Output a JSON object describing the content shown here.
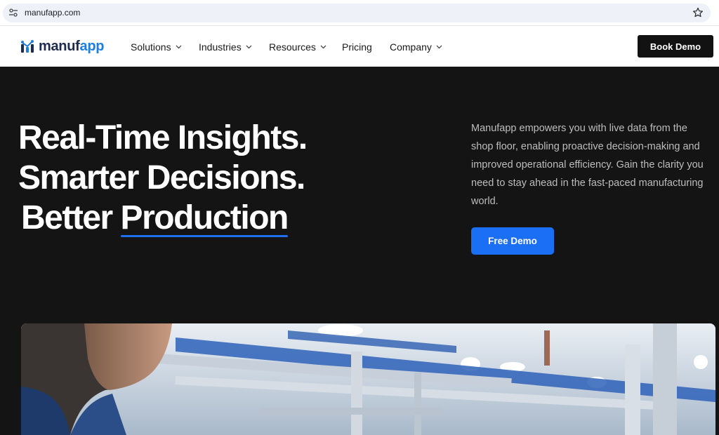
{
  "browser": {
    "url": "manufapp.com"
  },
  "nav": {
    "logo": {
      "part1": "manuf",
      "part2": "app"
    },
    "items": [
      {
        "label": "Solutions",
        "has_dropdown": true
      },
      {
        "label": "Industries",
        "has_dropdown": true
      },
      {
        "label": "Resources",
        "has_dropdown": true
      },
      {
        "label": "Pricing",
        "has_dropdown": false
      },
      {
        "label": "Company",
        "has_dropdown": true
      }
    ],
    "cta_label": "Book Demo"
  },
  "hero": {
    "headline": {
      "line1": "Real-Time Insights.",
      "line2": "Smarter Decisions.",
      "line3_prefix": "Better ",
      "line3_highlight": "Production"
    },
    "description": "Manufapp empowers you with live data from the shop floor, enabling proactive decision-making and improved operational efficiency. Gain the clarity you need to stay ahead in the fast-paced manufacturing world.",
    "cta_label": "Free Demo"
  },
  "colors": {
    "brand_dark": "#1d2b4f",
    "brand_blue": "#1e7fe0",
    "hero_bg": "#141414",
    "cta_blue": "#1a6ff5"
  }
}
